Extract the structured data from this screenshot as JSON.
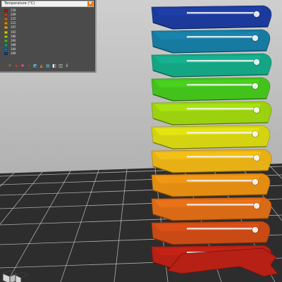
{
  "legend": {
    "title": "Temperature (°C)",
    "dropdown_icon": "dropdown-caret-icon",
    "items": [
      {
        "label": "220",
        "color": "#b72014"
      },
      {
        "label": "209",
        "color": "#c94a15"
      },
      {
        "label": "215",
        "color": "#d96a16"
      },
      {
        "label": "212",
        "color": "#e38c12"
      },
      {
        "label": "197",
        "color": "#e7b116"
      },
      {
        "label": "192",
        "color": "#d3d311"
      },
      {
        "label": "186",
        "color": "#9bd10f"
      },
      {
        "label": "184",
        "color": "#43c21b"
      },
      {
        "label": "180",
        "color": "#14a585"
      },
      {
        "label": "184",
        "color": "#177aa0"
      },
      {
        "label": "160",
        "color": "#1c3a9c"
      }
    ]
  },
  "toolbar": {
    "tools": [
      {
        "icon": "paint-fan-icon",
        "glyph": "☼",
        "tone": "orange"
      },
      {
        "icon": "layers-icon",
        "glyph": "◈",
        "tone": "red"
      },
      {
        "icon": "pin-icon",
        "glyph": "✱",
        "tone": "pink"
      },
      {
        "icon": "seam-icon",
        "glyph": "✧",
        "tone": "red"
      },
      {
        "icon": "shells-icon",
        "glyph": "◩",
        "tone": "cyan"
      },
      {
        "icon": "tool-marker-icon",
        "glyph": "◭",
        "tone": "orange"
      },
      {
        "icon": "legend-icon",
        "glyph": "▤",
        "tone": "cyan"
      },
      {
        "icon": "checker-icon",
        "glyph": "◧",
        "tone": "white"
      },
      {
        "icon": "cube-icon",
        "glyph": "◫",
        "tone": "white"
      },
      {
        "icon": "download-icon",
        "glyph": "⇩",
        "tone": "white"
      }
    ]
  },
  "scene": {
    "background_top": "#c9c9c9",
    "background_bottom": "#a2a2a2",
    "bed_color": "#2d2d2d",
    "grid_color": "#d8d8d8",
    "tower_bands": [
      "#1c3a9c",
      "#177aa0",
      "#14a585",
      "#43c21b",
      "#9bd10f",
      "#d3d311",
      "#e7b116",
      "#e38c12",
      "#d96a16",
      "#c94a15",
      "#b72014"
    ]
  }
}
